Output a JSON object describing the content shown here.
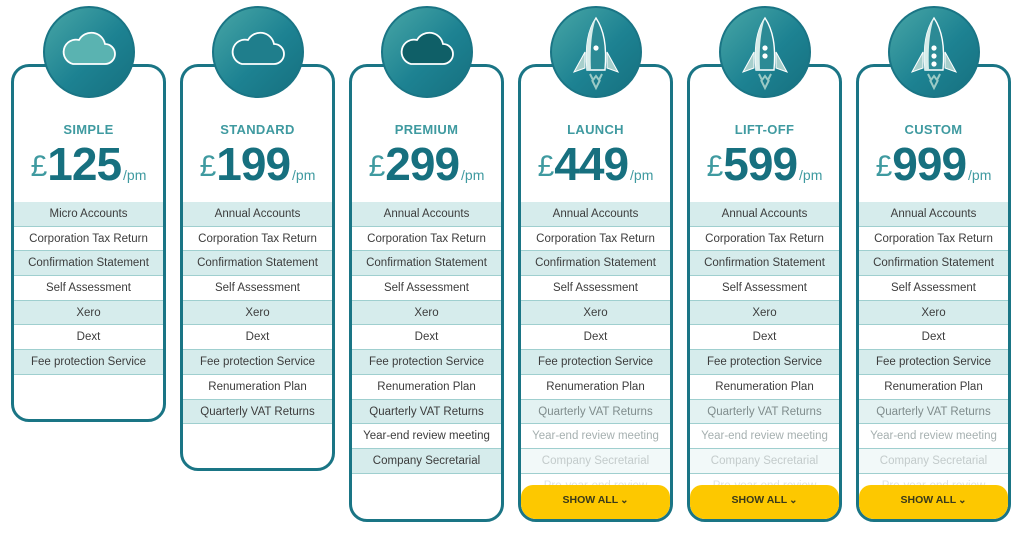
{
  "currency_symbol": "£",
  "period": "/pm",
  "show_all_label": "SHOW ALL",
  "colors": {
    "brand": "#1a7585",
    "accent_light": "#d6ecec",
    "cta": "#fdc800"
  },
  "plans": [
    {
      "name": "SIMPLE",
      "price": "125",
      "icon": "cloud-outline-icon",
      "features": [
        "Micro Accounts",
        "Corporation Tax Return",
        "Confirmation Statement",
        "Self Assessment",
        "Xero",
        "Dext",
        "Fee protection Service"
      ]
    },
    {
      "name": "STANDARD",
      "price": "199",
      "icon": "cloud-outline-icon",
      "features": [
        "Annual Accounts",
        "Corporation Tax Return",
        "Confirmation Statement",
        "Self Assessment",
        "Xero",
        "Dext",
        "Fee protection Service",
        "Renumeration Plan",
        "Quarterly VAT Returns"
      ]
    },
    {
      "name": "PREMIUM",
      "price": "299",
      "icon": "cloud-filled-icon",
      "features": [
        "Annual Accounts",
        "Corporation Tax Return",
        "Confirmation Statement",
        "Self Assessment",
        "Xero",
        "Dext",
        "Fee protection Service",
        "Renumeration Plan",
        "Quarterly VAT Returns",
        "Year-end review meeting",
        "Company Secretarial"
      ]
    },
    {
      "name": "LAUNCH",
      "price": "449",
      "icon": "rocket-icon",
      "features": [
        "Annual Accounts",
        "Corporation Tax Return",
        "Confirmation Statement",
        "Self Assessment",
        "Xero",
        "Dext",
        "Fee protection Service",
        "Renumeration Plan",
        "Quarterly VAT Returns",
        "Year-end review meeting",
        "Company Secretarial",
        "Pre-year-end review"
      ]
    },
    {
      "name": "LIFT-OFF",
      "price": "599",
      "icon": "rocket-icon",
      "features": [
        "Annual Accounts",
        "Corporation Tax Return",
        "Confirmation Statement",
        "Self Assessment",
        "Xero",
        "Dext",
        "Fee protection Service",
        "Renumeration Plan",
        "Quarterly VAT Returns",
        "Year-end review meeting",
        "Company Secretarial",
        "Pre-year-end review"
      ]
    },
    {
      "name": "CUSTOM",
      "price": "999",
      "icon": "rocket-icon",
      "features": [
        "Annual Accounts",
        "Corporation Tax Return",
        "Confirmation Statement",
        "Self Assessment",
        "Xero",
        "Dext",
        "Fee protection Service",
        "Renumeration Plan",
        "Quarterly VAT Returns",
        "Year-end review meeting",
        "Company Secretarial",
        "Pre-year-end review"
      ]
    }
  ]
}
